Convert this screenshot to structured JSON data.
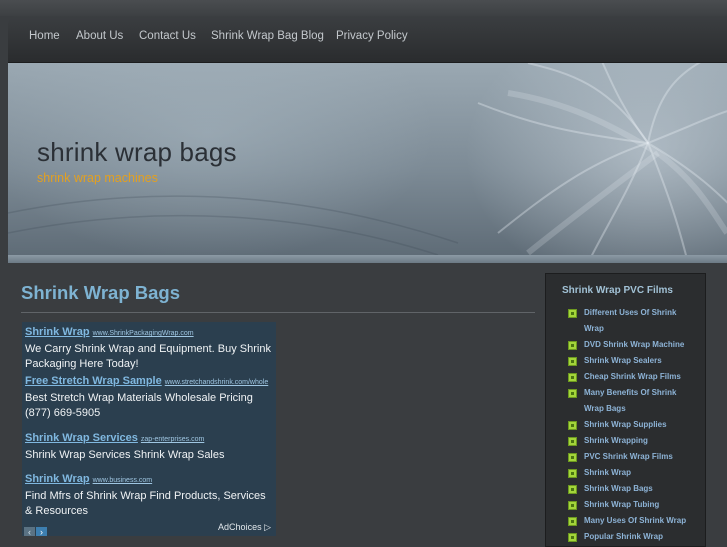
{
  "nav": {
    "items": [
      {
        "label": "Home"
      },
      {
        "label": "About Us"
      },
      {
        "label": "Contact Us"
      },
      {
        "label": "Shrink Wrap Bag Blog"
      },
      {
        "label": "Privacy Policy"
      }
    ]
  },
  "header": {
    "title": "shrink wrap bags",
    "tagline": "shrink wrap machines"
  },
  "content": {
    "title": "Shrink Wrap Bags"
  },
  "ads": [
    {
      "title": "Shrink Wrap",
      "url": "www.ShrinkPackagingWrap.com",
      "desc": "We Carry Shrink Wrap and Equipment. Buy Shrink Packaging Here Today!"
    },
    {
      "title": "Free Stretch Wrap Sample",
      "url": "www.stretchandshrink.com/whole",
      "desc": "Best Stretch Wrap Materials Wholesale Pricing (877) 669-5905"
    },
    {
      "title": "Shrink Wrap Services",
      "url": "zap-enterprises.com",
      "desc": "Shrink Wrap Services Shrink Wrap Sales"
    },
    {
      "title": "Shrink Wrap",
      "url": "www.business.com",
      "desc": "Find Mfrs of Shrink Wrap Find Products, Services & Resources"
    }
  ],
  "ad_controls": {
    "prev": "‹",
    "next": "›",
    "adchoices": "AdChoices ▷"
  },
  "sidebar": {
    "title": "Shrink Wrap PVC Films",
    "items": [
      {
        "label": "Different Uses Of Shrink Wrap"
      },
      {
        "label": "DVD Shrink Wrap Machine"
      },
      {
        "label": "Shrink Wrap Sealers"
      },
      {
        "label": "Cheap Shrink Wrap Films"
      },
      {
        "label": "Many Benefits Of Shrink Wrap Bags"
      },
      {
        "label": "Shrink Wrap Supplies"
      },
      {
        "label": "Shrink Wrapping"
      },
      {
        "label": "PVC Shrink Wrap Films"
      },
      {
        "label": "Shrink Wrap"
      },
      {
        "label": "Shrink Wrap Bags"
      },
      {
        "label": "Shrink Wrap Tubing"
      },
      {
        "label": "Many Uses Of Shrink Wrap"
      },
      {
        "label": "Popular Shrink Wrap"
      }
    ]
  },
  "colors": {
    "accent": "#7eb3d2",
    "tagline": "#e3a020",
    "bullet": "#a3d53a"
  }
}
